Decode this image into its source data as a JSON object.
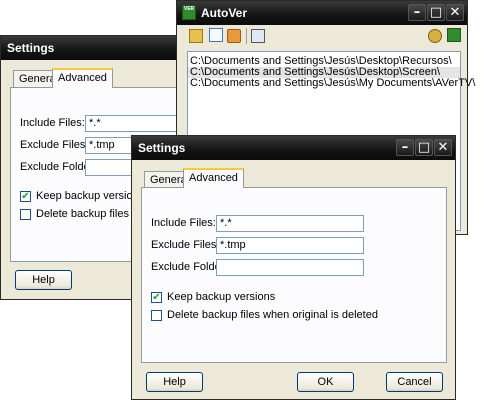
{
  "back_dialog": {
    "title": "Settings",
    "tabs": [
      {
        "label": "General"
      },
      {
        "label": "Advanced"
      }
    ],
    "include_label": "Include Files:",
    "include_value": "*.*",
    "exclude_label": "Exclude Files:",
    "exclude_value": "*.tmp",
    "exclude_folders_label": "Exclude Folders:",
    "keep_backup_label": "Keep backup versions",
    "delete_backup_label": "Delete backup files when",
    "help_label": "Help"
  },
  "autover": {
    "title": "AutoVer",
    "logo_text": "VER",
    "paths": [
      "C:\\Documents and Settings\\Jesús\\Desktop\\Recursos\\",
      "C:\\Documents and Settings\\Jesús\\Desktop\\Screen\\",
      "C:\\Documents and Settings\\Jesús\\My Documents\\AVerTV\\"
    ],
    "selected_index": 1
  },
  "front_dialog": {
    "title": "Settings",
    "tabs": [
      {
        "label": "General"
      },
      {
        "label": "Advanced"
      }
    ],
    "include_label": "Include Files:",
    "include_value": "*.*",
    "exclude_label": "Exclude Files:",
    "exclude_value": "*.tmp",
    "exclude_folders_label": "Exclude Folders:",
    "exclude_folders_value": "",
    "keep_backup_label": "Keep backup versions",
    "keep_backup_checked": true,
    "delete_backup_label": "Delete backup files when original is deleted",
    "delete_backup_checked": false,
    "help_label": "Help",
    "ok_label": "OK",
    "cancel_label": "Cancel"
  },
  "icons": {
    "minimize": "minimize-icon",
    "maximize": "maximize-icon",
    "close": "close-icon"
  },
  "colors": {
    "titlebar": "#141414",
    "dialog_bg": "#ece9d8",
    "active_tab_accent": "#ffc83c",
    "check_mark": "#21a121"
  }
}
